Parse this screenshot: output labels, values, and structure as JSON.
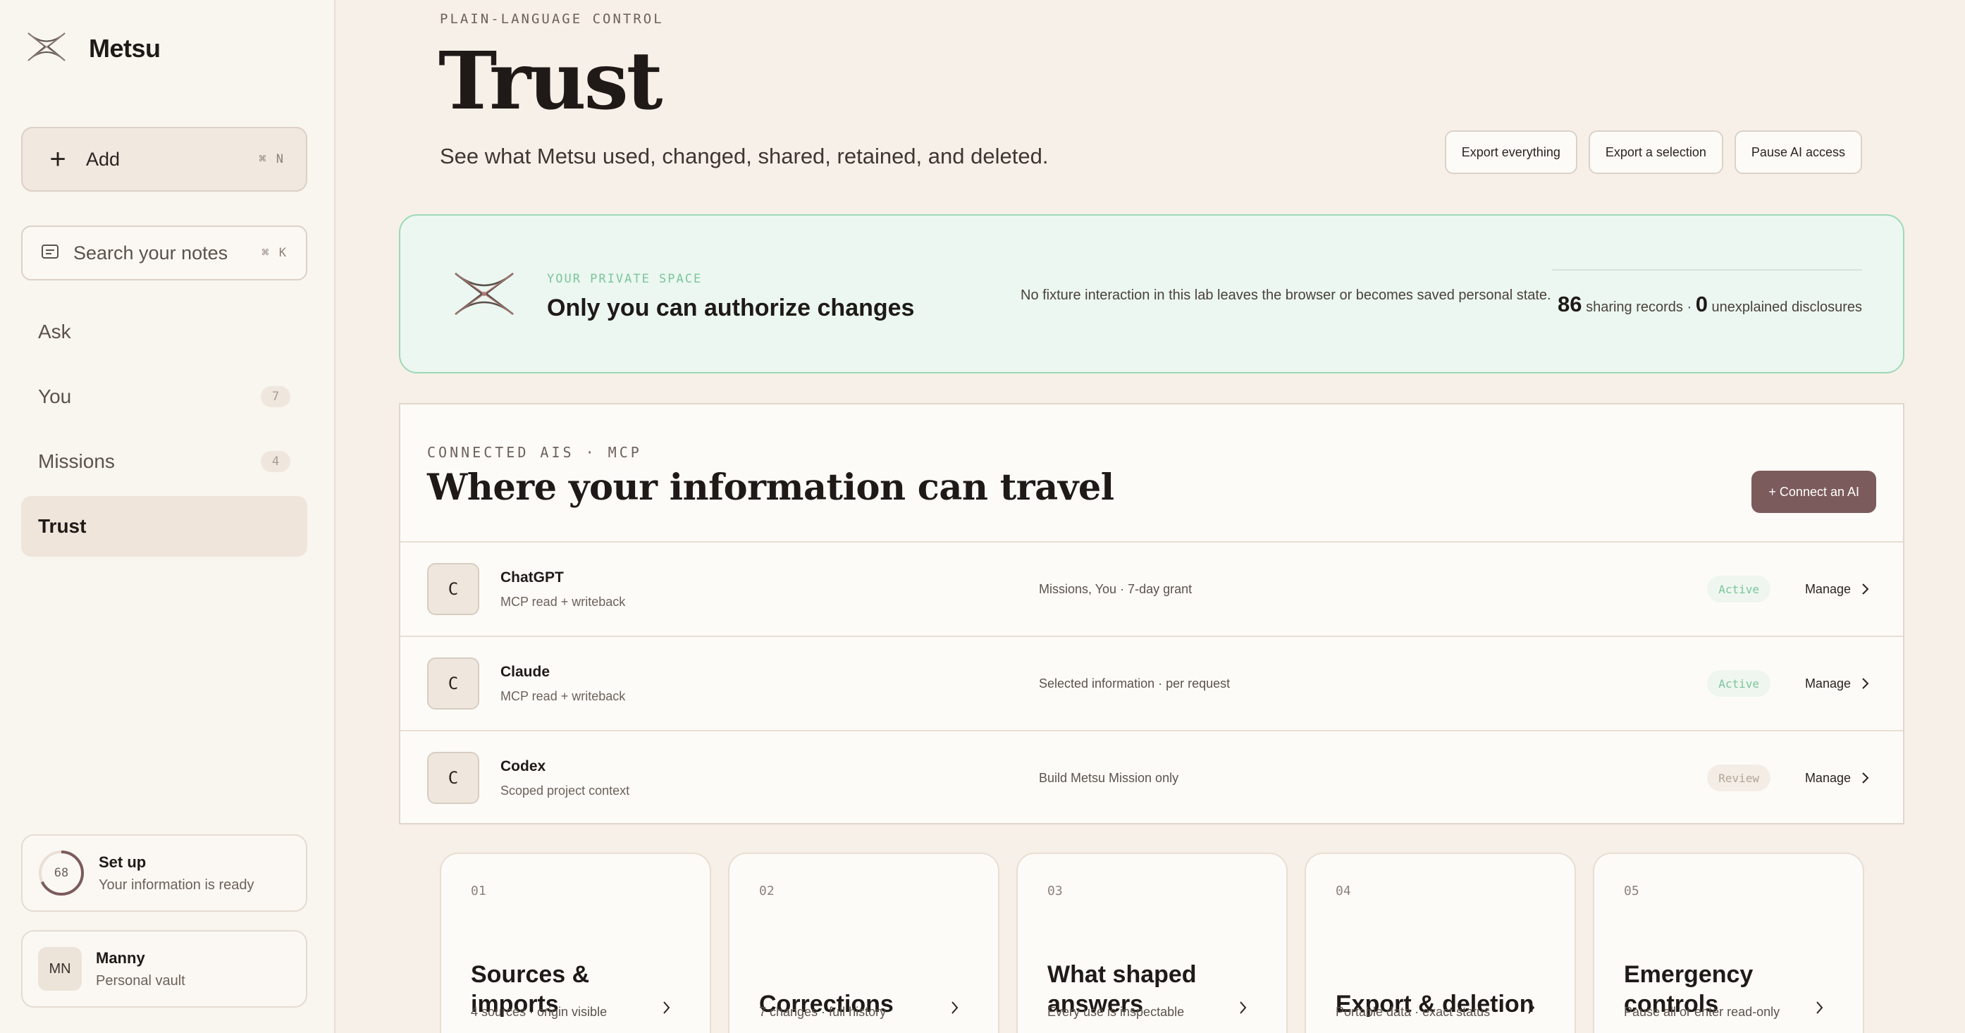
{
  "app": {
    "name": "Metsu"
  },
  "sidebar": {
    "add": {
      "label": "Add",
      "shortcut": "⌘ N"
    },
    "search": {
      "placeholder": "Search your notes",
      "shortcut": "⌘ K"
    },
    "nav": [
      {
        "label": "Ask",
        "badge": ""
      },
      {
        "label": "You",
        "badge": "7"
      },
      {
        "label": "Missions",
        "badge": "4"
      },
      {
        "label": "Trust",
        "badge": ""
      }
    ],
    "setup": {
      "progress": "68",
      "title": "Set up",
      "subtitle": "Your information is ready"
    },
    "user": {
      "initials": "MN",
      "name": "Manny",
      "subtitle": "Personal vault"
    }
  },
  "header": {
    "eyebrow": "PLAIN-LANGUAGE CONTROL",
    "title": "Trust",
    "subtitle": "See what Metsu used, changed, shared, retained, and deleted.",
    "actions": [
      "Export everything",
      "Export a selection",
      "Pause AI access"
    ]
  },
  "private_space": {
    "eyebrow": "YOUR PRIVATE SPACE",
    "title": "Only you can authorize changes",
    "note": "No fixture interaction in this lab leaves the browser or becomes saved personal state.",
    "sharing_count": "86",
    "sharing_label": "sharing records",
    "separator": "·",
    "disclosure_count": "0",
    "disclosure_label": "unexplained disclosures"
  },
  "connected": {
    "eyebrow": "CONNECTED AIS · MCP",
    "title": "Where your information can travel",
    "connect_label": "+ Connect an AI",
    "manage_label": "Manage",
    "rows": [
      {
        "initial": "C",
        "name": "ChatGPT",
        "sub": "MCP read + writeback",
        "scope": "Missions, You · 7-day grant",
        "status": "Active"
      },
      {
        "initial": "C",
        "name": "Claude",
        "sub": "MCP read + writeback",
        "scope": "Selected information · per request",
        "status": "Active"
      },
      {
        "initial": "C",
        "name": "Codex",
        "sub": "Scoped project context",
        "scope": "Build Metsu Mission only",
        "status": "Review"
      }
    ]
  },
  "features": [
    {
      "num": "01",
      "title": "Sources & imports",
      "sub": "4 sources · origin visible"
    },
    {
      "num": "02",
      "title": "Corrections",
      "sub": "7 changes · full history"
    },
    {
      "num": "03",
      "title": "What shaped answers",
      "sub": "Every use is inspectable"
    },
    {
      "num": "04",
      "title": "Export & deletion",
      "sub": "Portable data · exact status"
    },
    {
      "num": "05",
      "title": "Emergency controls",
      "sub": "Pause all or enter read-only"
    }
  ],
  "colors": {
    "accent": "#7c5b5c",
    "private_bg": "#ebf7f0",
    "active_green": "#7cc59a"
  }
}
